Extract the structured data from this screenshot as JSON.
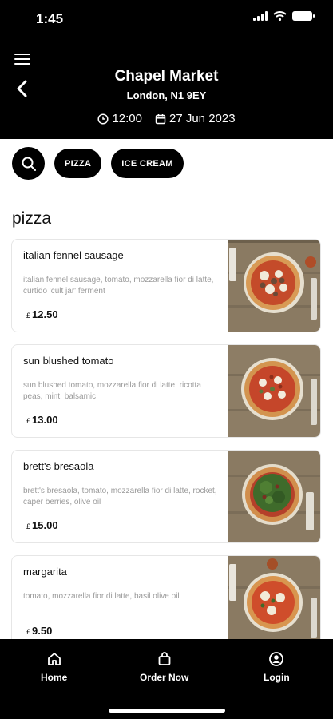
{
  "status_bar": {
    "time": "1:45"
  },
  "header": {
    "title": "Chapel Market",
    "address": "London, N1 9EY",
    "time": "12:00",
    "date": "27 Jun 2023"
  },
  "filters": {
    "chips": [
      "PIZZA",
      "ICE CREAM"
    ]
  },
  "section": {
    "title": "pizza"
  },
  "currency": "£",
  "items": [
    {
      "name": "italian fennel sausage",
      "description": "italian fennel sausage, tomato, mozzarella fior di latte, curtido 'cult jar' ferment",
      "price": "12.50"
    },
    {
      "name": "sun blushed tomato",
      "description": "sun blushed tomato, mozzarella fior di latte, ricotta peas, mint, balsamic",
      "price": "13.00"
    },
    {
      "name": "brett's bresaola",
      "description": "brett's bresaola, tomato, mozzarella fior di latte, rocket, caper berries, olive oil",
      "price": "15.00"
    },
    {
      "name": "margarita",
      "description": "tomato, mozzarella fior di latte, basil olive oil",
      "price": "9.50"
    }
  ],
  "bottom_nav": {
    "home": "Home",
    "order": "Order Now",
    "login": "Login"
  },
  "colors": {
    "bar": "#000000",
    "accent": "#ffffff"
  }
}
